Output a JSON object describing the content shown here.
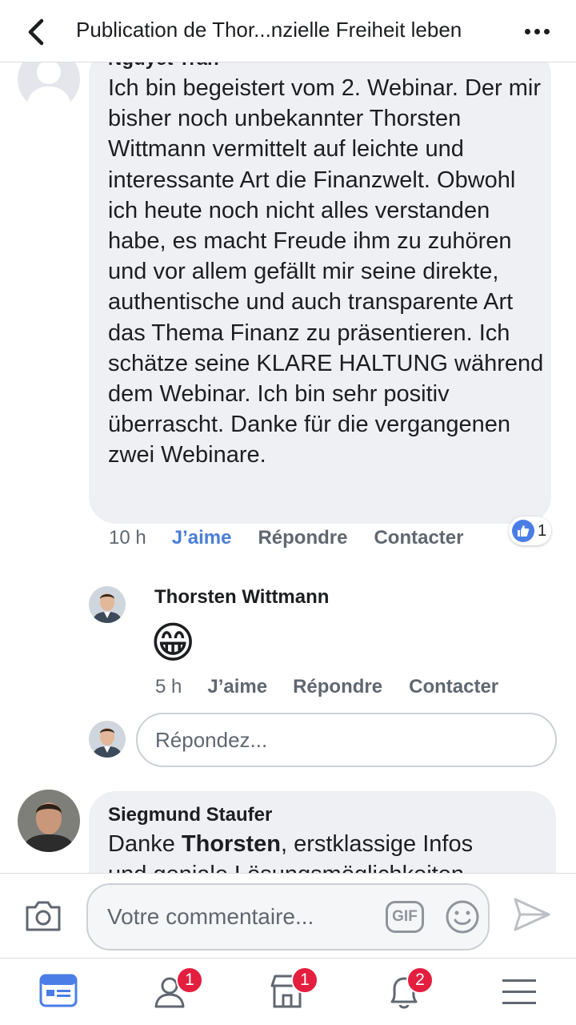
{
  "header": {
    "title": "Publication de Thor...nzielle Freiheit leben"
  },
  "comments": [
    {
      "author": "Nguyet Tran",
      "text": "Ich bin begeistert vom 2. Webinar. Der mir bisher noch unbekannter Thorsten Wittmann vermittelt auf leichte und interessante Art die Finanzwelt. Obwohl ich heute noch nicht alles verstanden habe, es macht Freude ihm zu zuhören und vor allem gefällt mir seine direkte, authentische und auch transparente Art das Thema Finanz zu präsentieren. Ich schätze seine KLARE HALTUNG während dem Webinar. Ich bin sehr positiv überrascht. Danke für die vergangenen zwei Webinare.",
      "time": "10 h",
      "like_label": "J’aime",
      "reply_label": "Répondre",
      "contact_label": "Contacter",
      "reaction_count": "1"
    },
    {
      "author": "Thorsten Wittmann",
      "emoji": "😁",
      "time": "5 h",
      "like_label": "J’aime",
      "reply_label": "Répondre",
      "contact_label": "Contacter"
    },
    {
      "author": "Siegmund Staufer",
      "text_prefix": "Danke ",
      "text_bold": "Thorsten",
      "text_suffix": ", erstklassige Infos",
      "text_line2": "und geniale Lösungsmöglichkeiten"
    }
  ],
  "reply_box": {
    "placeholder": "Répondez..."
  },
  "composer": {
    "placeholder": "Votre commentaire...",
    "gif_label": "GIF"
  },
  "tabbar": {
    "friends_badge": "1",
    "marketplace_badge": "1",
    "notifications_badge": "2"
  },
  "colors": {
    "accent": "#4a7ee6",
    "bubble": "#eff0f3",
    "badge": "#e41e3f"
  }
}
